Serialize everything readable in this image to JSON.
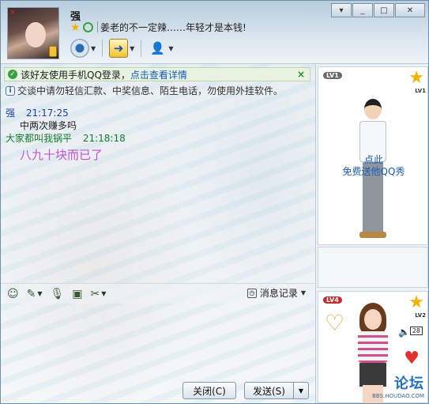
{
  "window": {
    "controls": {
      "menu": "▾",
      "minimize": "_",
      "maximize": "□",
      "close": "✕"
    }
  },
  "header": {
    "nickname": "强",
    "signature": "姜老的不一定辣……年轻才是本钱!"
  },
  "notices": {
    "mobile_prefix": "该好友使用手机QQ登录，",
    "mobile_link": "点击查看详情",
    "security": "交谈中请勿轻信汇款、中奖信息、陌生电话，勿使用外挂软件。"
  },
  "messages": [
    {
      "sender": "强",
      "time": "21:17:25",
      "text": "中两次赚多吗"
    },
    {
      "sender": "大家都叫我锅平",
      "time": "21:18:18",
      "text": "八九十块而已了"
    }
  ],
  "input_toolbar": {
    "history_label": "消息记录"
  },
  "buttons": {
    "close": "关闭(C)",
    "send": "发送(S)"
  },
  "right_panel": {
    "show1": {
      "level": "LV1",
      "star_level": "LV1",
      "line1": "点此",
      "line2": "免费送他QQ秀"
    },
    "show2": {
      "level": "LV4",
      "star_level": "LV2",
      "badge": "28"
    },
    "watermark": {
      "main": "论坛",
      "url": "BBS.HOUDAO.COM"
    }
  },
  "colors": {
    "self_name": "#1a3fa8",
    "other_name": "#1a7a2a",
    "big_message": "#c055d0",
    "link": "#1a5bb8"
  }
}
